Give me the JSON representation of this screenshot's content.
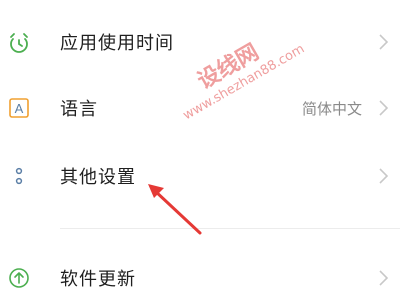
{
  "settings": {
    "items": [
      {
        "label": "应用使用时间",
        "value": "",
        "icon": "app-usage-timer-icon"
      },
      {
        "label": "语言",
        "value": "简体中文",
        "icon": "language-icon"
      },
      {
        "label": "其他设置",
        "value": "",
        "icon": "more-settings-icon"
      },
      {
        "label": "软件更新",
        "value": "",
        "icon": "software-update-icon"
      }
    ],
    "language_icon_letter": "A"
  },
  "watermark": {
    "line1": "设线网",
    "line2": "www.shezhan88.com"
  },
  "colors": {
    "icon_green": "#4caf50",
    "icon_orange": "#f0a030",
    "icon_blue": "#5b7fa6",
    "annotation_red": "#e53935",
    "chevron": "#c8c8c8",
    "text_primary": "#1f1f1f",
    "text_secondary": "#8a8a8a"
  }
}
